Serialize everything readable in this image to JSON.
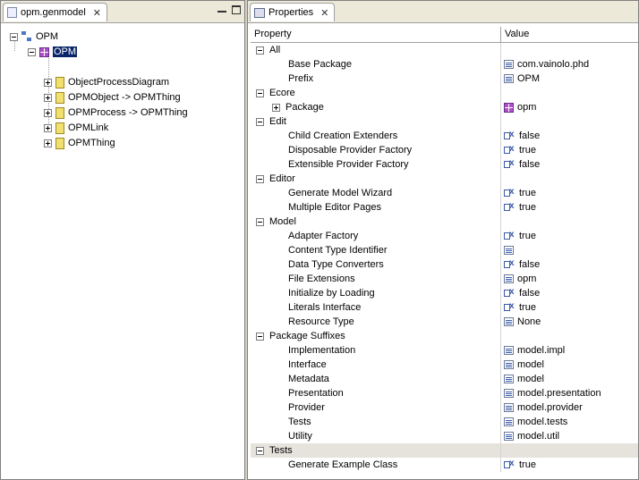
{
  "left": {
    "tab_title": "opm.genmodel",
    "tree": {
      "root": "OPM",
      "package": "OPM",
      "children": [
        "ObjectProcessDiagram",
        "OPMObject -> OPMThing",
        "OPMProcess -> OPMThing",
        "OPMLink",
        "OPMThing"
      ]
    }
  },
  "right": {
    "tab_title": "Properties",
    "columns": [
      "Property",
      "Value"
    ],
    "categories": [
      {
        "name": "All",
        "rows": [
          {
            "p": "Base Package",
            "v": "com.vainolo.phd",
            "icon": "text"
          },
          {
            "p": "Prefix",
            "v": "OPM",
            "icon": "text"
          }
        ]
      },
      {
        "name": "Ecore",
        "rows": [
          {
            "p": "Package",
            "v": "opm",
            "icon": "package"
          }
        ]
      },
      {
        "name": "Edit",
        "rows": [
          {
            "p": "Child Creation Extenders",
            "v": "false",
            "icon": "bool"
          },
          {
            "p": "Disposable Provider Factory",
            "v": "true",
            "icon": "bool"
          },
          {
            "p": "Extensible Provider Factory",
            "v": "false",
            "icon": "bool"
          }
        ]
      },
      {
        "name": "Editor",
        "rows": [
          {
            "p": "Generate Model Wizard",
            "v": "true",
            "icon": "bool"
          },
          {
            "p": "Multiple Editor Pages",
            "v": "true",
            "icon": "bool"
          }
        ]
      },
      {
        "name": "Model",
        "rows": [
          {
            "p": "Adapter Factory",
            "v": "true",
            "icon": "bool"
          },
          {
            "p": "Content Type Identifier",
            "v": "",
            "icon": "text"
          },
          {
            "p": "Data Type Converters",
            "v": "false",
            "icon": "bool"
          },
          {
            "p": "File Extensions",
            "v": "opm",
            "icon": "text"
          },
          {
            "p": "Initialize by Loading",
            "v": "false",
            "icon": "bool"
          },
          {
            "p": "Literals Interface",
            "v": "true",
            "icon": "bool"
          },
          {
            "p": "Resource Type",
            "v": "None",
            "icon": "text"
          }
        ]
      },
      {
        "name": "Package Suffixes",
        "rows": [
          {
            "p": "Implementation",
            "v": "model.impl",
            "icon": "text"
          },
          {
            "p": "Interface",
            "v": "model",
            "icon": "text"
          },
          {
            "p": "Metadata",
            "v": "model",
            "icon": "text"
          },
          {
            "p": "Presentation",
            "v": "model.presentation",
            "icon": "text"
          },
          {
            "p": "Provider",
            "v": "model.provider",
            "icon": "text"
          },
          {
            "p": "Tests",
            "v": "model.tests",
            "icon": "text"
          },
          {
            "p": "Utility",
            "v": "model.util",
            "icon": "text"
          }
        ]
      },
      {
        "name": "Tests",
        "rows": [
          {
            "p": "Generate Example Class",
            "v": "true",
            "icon": "bool"
          }
        ]
      }
    ]
  }
}
